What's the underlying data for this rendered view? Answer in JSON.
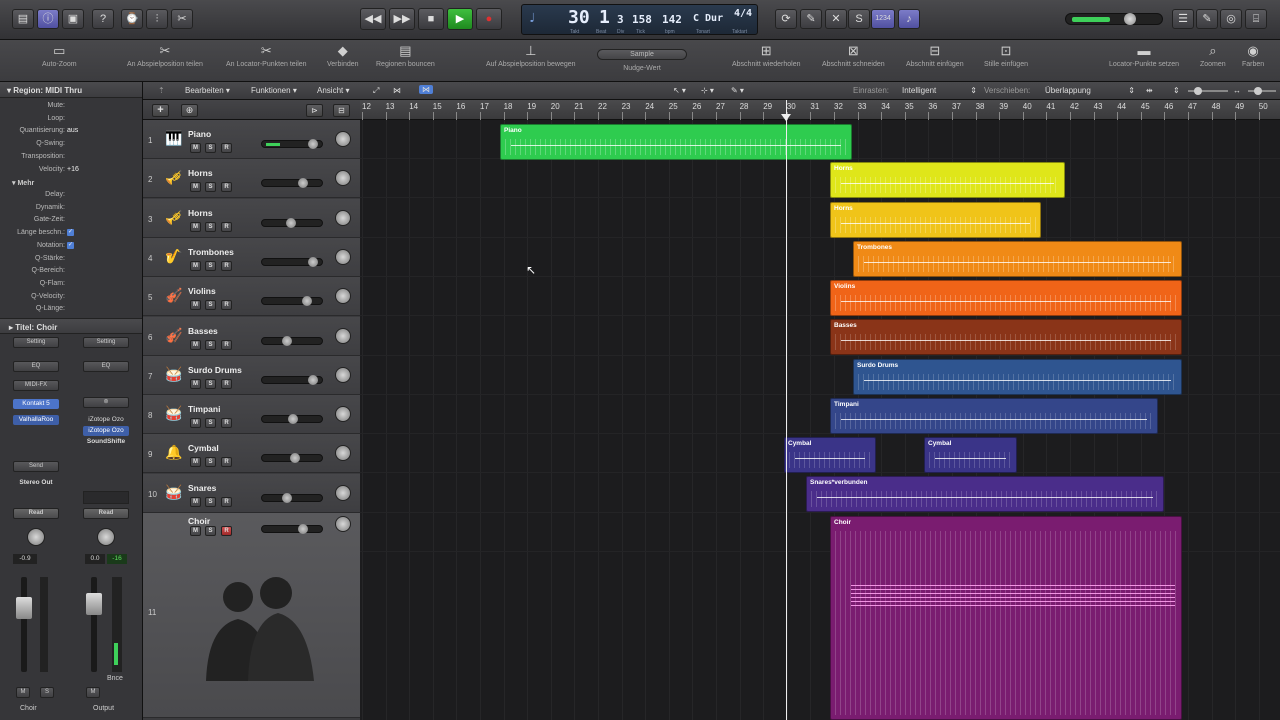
{
  "transport": {
    "bar": "30",
    "beat": "1",
    "div": "3",
    "tick": "158",
    "tempo": "142",
    "key": "C Dur",
    "sig": "4/4",
    "lbl_takt": "Takt",
    "lbl_beat": "Beat",
    "lbl_div": "Div",
    "lbl_tick": "Tick",
    "lbl_bpm": "bpm",
    "lbl_tonart": "Tonart",
    "lbl_taktart": "Taktart",
    "counter": "1234"
  },
  "toolbar": {
    "items": [
      "Auto-Zoom",
      "An Abspielposition teilen",
      "An Locator-Punkten teilen",
      "Verbinden",
      "Regionen bouncen",
      "Auf Abspielposition bewegen",
      "Nudge-Wert",
      "Abschnitt wiederholen",
      "Abschnitt schneiden",
      "Abschnitt einfügen",
      "Stille einfügen",
      "Locator-Punkte setzen",
      "Zoomen",
      "Farben"
    ],
    "nudge_value": "Sample"
  },
  "inspector": {
    "region_title": "Region: MIDI Thru",
    "rows": [
      {
        "label": "Mute:",
        "value": ""
      },
      {
        "label": "Loop:",
        "value": ""
      },
      {
        "label": "Quantisierung:",
        "value": "aus"
      },
      {
        "label": "Q-Swing:",
        "value": ""
      },
      {
        "label": "Transposition:",
        "value": ""
      },
      {
        "label": "Velocity:",
        "value": "+16"
      }
    ],
    "more": "Mehr",
    "rows2": [
      {
        "label": "Delay:",
        "value": ""
      },
      {
        "label": "Dynamik:",
        "value": ""
      },
      {
        "label": "Gate-Zeit:",
        "value": ""
      },
      {
        "label": "Länge beschn.:",
        "value": "✓"
      },
      {
        "label": "Notation:",
        "value": "✓"
      },
      {
        "label": "Q-Stärke:",
        "value": ""
      },
      {
        "label": "Q-Bereich:",
        "value": ""
      },
      {
        "label": "Q-Flam:",
        "value": ""
      },
      {
        "label": "Q-Velocity:",
        "value": ""
      },
      {
        "label": "Q-Länge:",
        "value": ""
      }
    ],
    "track_title": "Titel: Choir",
    "strip1": {
      "setting": "Setting",
      "eq": "EQ",
      "midifx": "MIDI-FX",
      "plugin1": "Kontakt 5",
      "plugin2": "ValhallaRoo",
      "send": "Send",
      "out": "Stereo Out",
      "auto": "Read",
      "vol": "-0.9",
      "name": "Choir",
      "m": "M",
      "s": "S"
    },
    "strip2": {
      "setting": "Setting",
      "eq": "EQ",
      "link": "⊚",
      "plugin1": "iZotope Ozo",
      "plugin2": "iZotope Ozo",
      "plugin3": "SoundShifte",
      "auto": "Read",
      "vol": "0.0",
      "peak": "-16",
      "bnce": "Bnce",
      "name": "Output",
      "m": "M"
    }
  },
  "header": {
    "edit": "Bearbeiten",
    "functions": "Funktionen",
    "view": "Ansicht",
    "snap_label": "Einrasten:",
    "snap_value": "Intelligent",
    "drag_label": "Verschieben:",
    "drag_value": "Überlappung"
  },
  "ruler": {
    "bars": [
      "12",
      "13",
      "14",
      "15",
      "16",
      "17",
      "18",
      "19",
      "20",
      "21",
      "22",
      "23",
      "24",
      "25",
      "26",
      "27",
      "28",
      "29",
      "30",
      "31",
      "32",
      "33",
      "34",
      "35",
      "36",
      "37",
      "38",
      "39",
      "40",
      "41",
      "42",
      "43",
      "44",
      "45",
      "46",
      "47",
      "48",
      "49",
      "50"
    ]
  },
  "tracks": [
    {
      "num": "1",
      "name": "Piano",
      "icon": "🎹"
    },
    {
      "num": "2",
      "name": "Horns",
      "icon": "🎺"
    },
    {
      "num": "3",
      "name": "Horns",
      "icon": "🎺"
    },
    {
      "num": "4",
      "name": "Trombones",
      "icon": "🎷"
    },
    {
      "num": "5",
      "name": "Violins",
      "icon": "🎻"
    },
    {
      "num": "6",
      "name": "Basses",
      "icon": "🎻"
    },
    {
      "num": "7",
      "name": "Surdo Drums",
      "icon": "🥁"
    },
    {
      "num": "8",
      "name": "Timpani",
      "icon": "🥁"
    },
    {
      "num": "9",
      "name": "Cymbal",
      "icon": "🔔"
    },
    {
      "num": "10",
      "name": "Snares",
      "icon": "🥁"
    },
    {
      "num": "11",
      "name": "Choir",
      "icon": ""
    }
  ],
  "msr": {
    "m": "M",
    "s": "S",
    "r": "R"
  },
  "regions": [
    {
      "name": "Piano",
      "color": "#2ecc4f"
    },
    {
      "name": "Horns",
      "color": "#dfe61a"
    },
    {
      "name": "Horns",
      "color": "#f0c419"
    },
    {
      "name": "Trombones",
      "color": "#f08a16"
    },
    {
      "name": "Violins",
      "color": "#f06418"
    },
    {
      "name": "Basses",
      "color": "#8a3418"
    },
    {
      "name": "Surdo Drums",
      "color": "#2f5590"
    },
    {
      "name": "Timpani",
      "color": "#34468a"
    },
    {
      "name": "Cymbal",
      "color": "#3a3488"
    },
    {
      "name": "Cymbal",
      "color": "#3a3488"
    },
    {
      "name": "Snares*verbunden",
      "color": "#4a2d8a"
    },
    {
      "name": "Choir",
      "color": "#7a1c70"
    }
  ]
}
